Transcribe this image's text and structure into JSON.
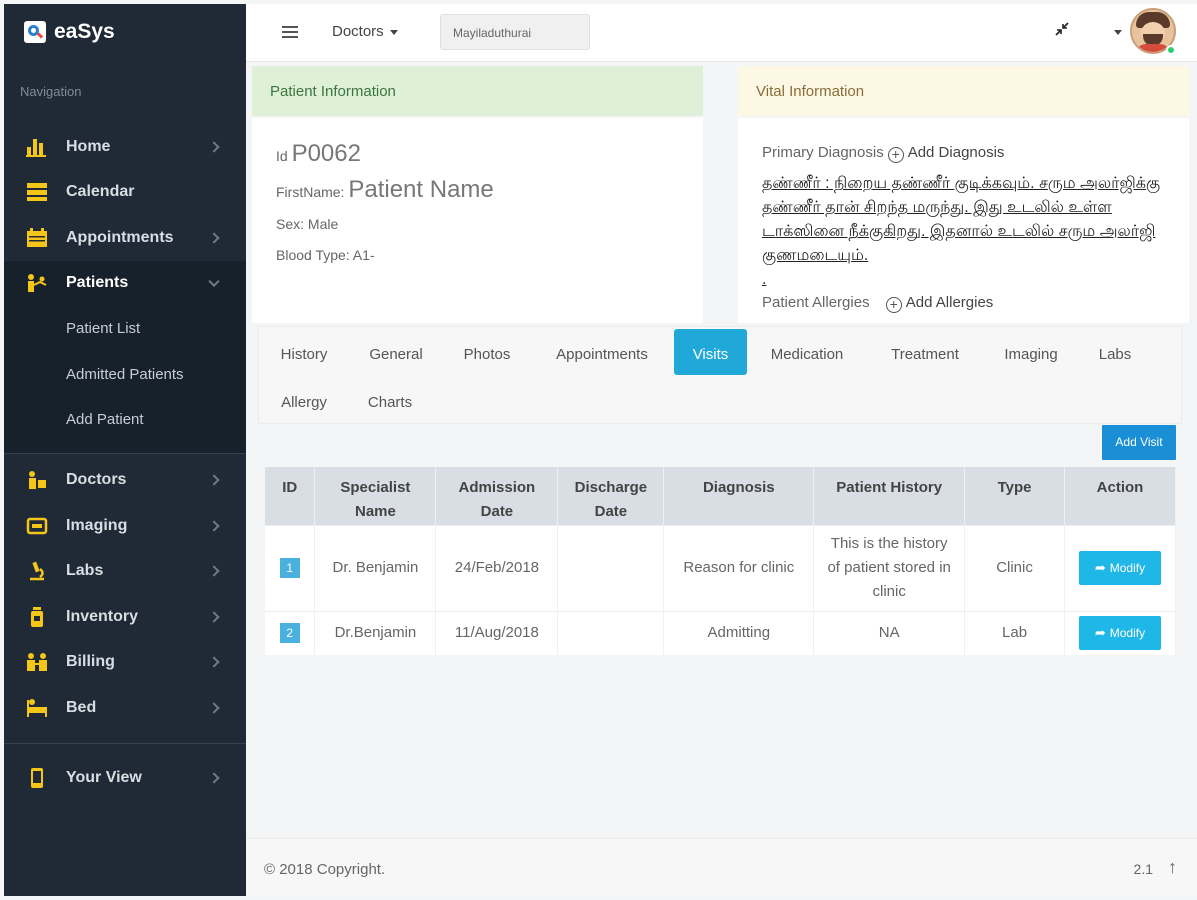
{
  "app": {
    "name": "eaSys"
  },
  "sidebar": {
    "heading": "Navigation",
    "items": [
      {
        "label": "Home",
        "icon": "bar-chart-icon"
      },
      {
        "label": "Calendar",
        "icon": "server-icon"
      },
      {
        "label": "Appointments",
        "icon": "calendar-icon"
      },
      {
        "label": "Patients",
        "icon": "patients-icon"
      }
    ],
    "sub_items": [
      {
        "label": "Patient List"
      },
      {
        "label": "Admitted Patients"
      },
      {
        "label": "Add Patient"
      }
    ],
    "items2": [
      {
        "label": "Doctors",
        "icon": "doctor-icon"
      },
      {
        "label": "Imaging",
        "icon": "imaging-icon"
      },
      {
        "label": "Labs",
        "icon": "microscope-icon"
      },
      {
        "label": "Inventory",
        "icon": "bottle-icon"
      },
      {
        "label": "Billing",
        "icon": "billing-icon"
      },
      {
        "label": "Bed",
        "icon": "bed-icon"
      }
    ],
    "items3": [
      {
        "label": "Your View",
        "icon": "mobile-icon"
      }
    ]
  },
  "topbar": {
    "doctors_label": "Doctors",
    "location": "Mayiladuthurai"
  },
  "patient_info": {
    "title": "Patient Information",
    "id_label": "Id",
    "id_value": "P0062",
    "firstname_label": "FirstName:",
    "firstname_value": "Patient Name",
    "sex": "Sex: Male",
    "blood_type": "Blood Type: A1-"
  },
  "vital_info": {
    "title": "Vital Information",
    "primary_diagnosis_label": "Primary Diagnosis",
    "add_diagnosis": "Add Diagnosis",
    "diagnosis_text": "தண்ணீர் : நிறைய தண்ணீர் குடிக்கவும். சரும அலர்ஜிக்கு தண்ணீர் தான் சிறந்த மருந்து. இது உடலில் உள்ள டாக்ஸினை நீக்குகிறது. இதனால் உடலில் சரும அலர்ஜி குணமடையும்.",
    "diagnosis_tail": ".",
    "allergies_label": "Patient Allergies",
    "add_allergies": "Add Allergies"
  },
  "tabs": [
    {
      "label": "History"
    },
    {
      "label": "General"
    },
    {
      "label": "Photos"
    },
    {
      "label": "Appointments"
    },
    {
      "label": "Visits"
    },
    {
      "label": "Medication"
    },
    {
      "label": "Treatment"
    },
    {
      "label": "Imaging"
    },
    {
      "label": "Labs"
    },
    {
      "label": "Allergy"
    },
    {
      "label": "Charts"
    }
  ],
  "active_tab": "Visits",
  "add_visit_label": "Add Visit",
  "table": {
    "headers": [
      {
        "label": "ID"
      },
      {
        "label": "Specialist Name"
      },
      {
        "label": "Admission Date"
      },
      {
        "label": "Discharge Date"
      },
      {
        "label": "Diagnosis"
      },
      {
        "label": "Patient History"
      },
      {
        "label": "Type"
      },
      {
        "label": "Action"
      }
    ],
    "rows": [
      {
        "id": "1",
        "specialist": "Dr. Benjamin",
        "admission": "24/Feb/2018",
        "discharge": "",
        "diagnosis": "Reason for clinic",
        "history": "This is the history of patient stored in clinic",
        "type": "Clinic",
        "action": "Modify"
      },
      {
        "id": "2",
        "specialist": "Dr.Benjamin",
        "admission": "11/Aug/2018",
        "discharge": "",
        "diagnosis": "Admitting",
        "history": "NA",
        "type": "Lab",
        "action": "Modify"
      }
    ]
  },
  "footer": {
    "copyright": "© 2018 Copyright.",
    "version": "2.1"
  },
  "colors": {
    "sidebar_bg": "#1f2a36",
    "accent_yellow": "#f5c518",
    "active_tab": "#1fa8d8",
    "add_visit": "#1a8fd6",
    "patient_info_bg": "#dff0d8",
    "vital_info_bg": "#fcf8e3"
  }
}
